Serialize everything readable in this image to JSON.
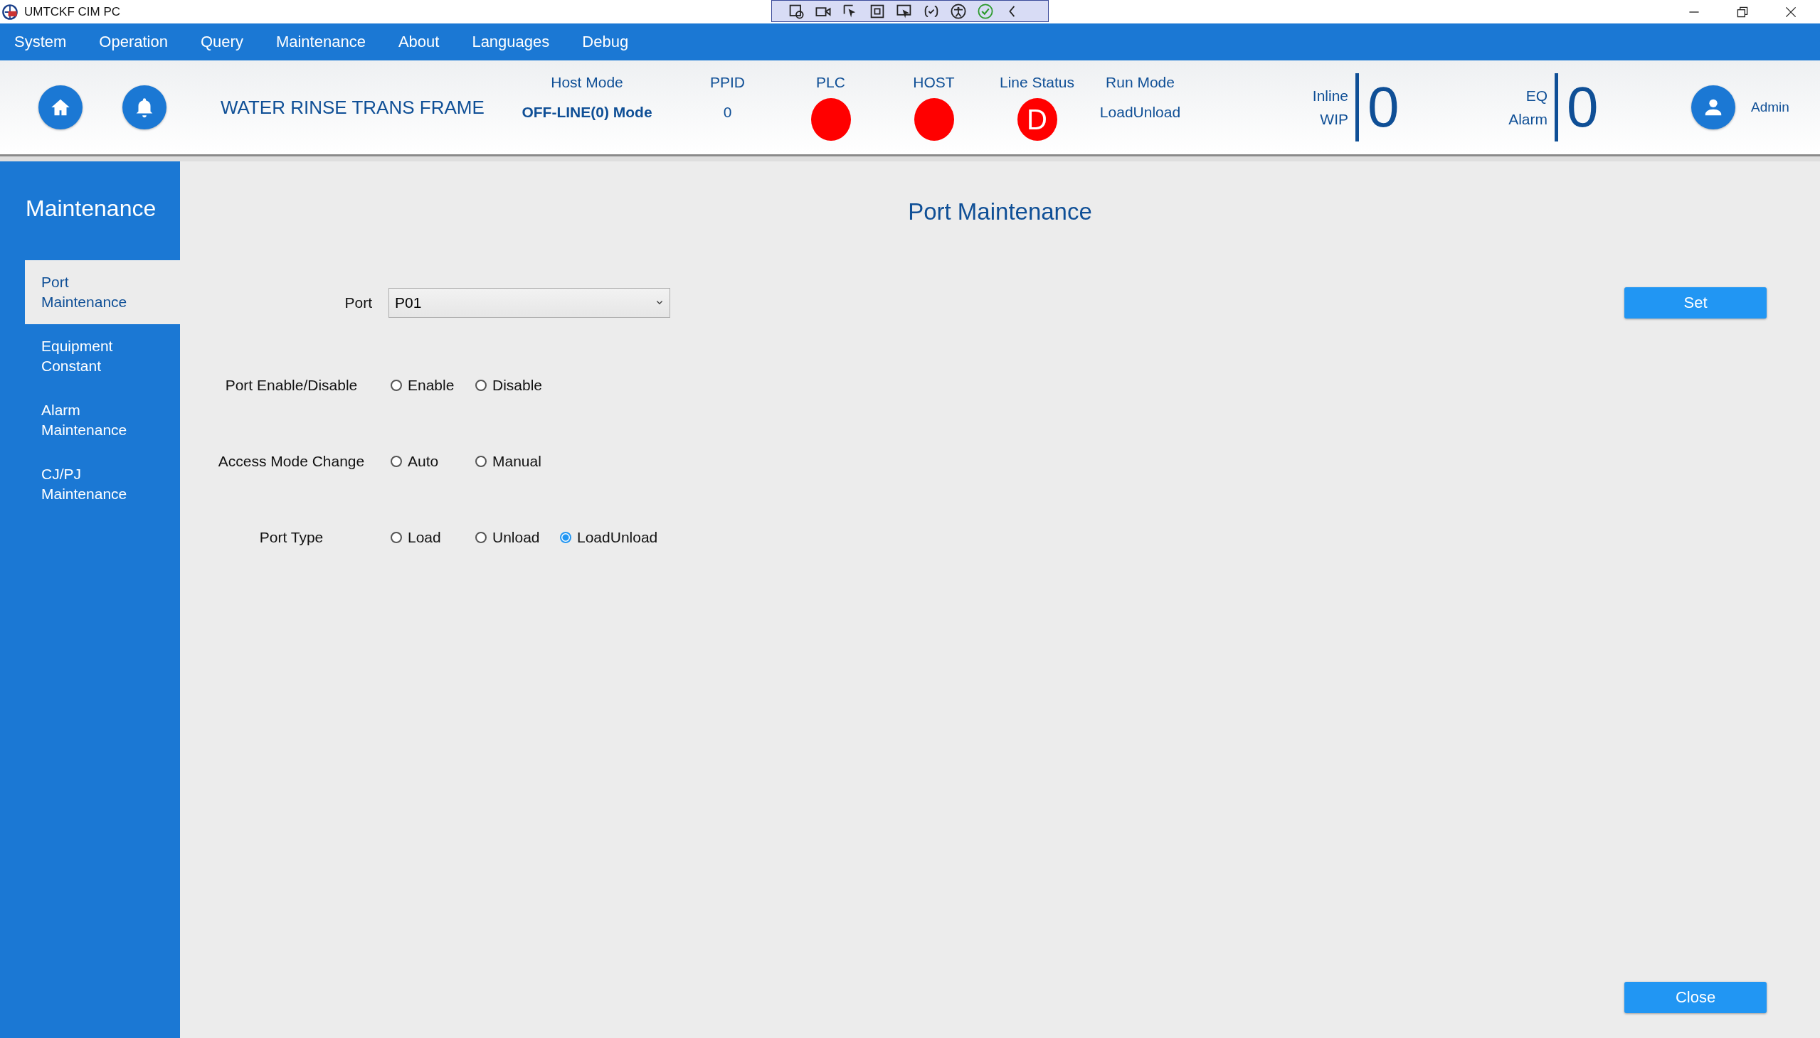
{
  "window": {
    "title": "UMTCKF CIM PC"
  },
  "menu": [
    "System",
    "Operation",
    "Query",
    "Maintenance",
    "About",
    "Languages",
    "Debug"
  ],
  "header": {
    "title": "WATER RINSE TRANS FRAME",
    "status": [
      {
        "label": "Host Mode",
        "kind": "text",
        "value": "OFF-LINE(0) Mode",
        "bold": true
      },
      {
        "label": "PPID",
        "kind": "text",
        "value": "0",
        "bold": false
      },
      {
        "label": "PLC",
        "kind": "lamp",
        "color": "#ff0000"
      },
      {
        "label": "HOST",
        "kind": "lamp",
        "color": "#ff0000"
      },
      {
        "label": "Line Status",
        "kind": "lamp",
        "color": "#ff0000",
        "value": "D"
      },
      {
        "label": "Run Mode",
        "kind": "text",
        "value": "LoadUnload",
        "bold": false
      }
    ],
    "counters": [
      {
        "label": "Inline WIP",
        "value": "0"
      },
      {
        "label": "EQ Alarm",
        "value": "0"
      }
    ],
    "user": "Admin"
  },
  "sidebar": {
    "title": "Maintenance",
    "items": [
      {
        "label": "Port Maintenance",
        "selected": true
      },
      {
        "label": "Equipment Constant",
        "selected": false
      },
      {
        "label": "Alarm Maintenance",
        "selected": false
      },
      {
        "label": "CJ/PJ Maintenance",
        "selected": false
      }
    ]
  },
  "content": {
    "title": "Port Maintenance",
    "port": {
      "label": "Port",
      "value": "P01"
    },
    "groups": [
      {
        "label": "Port Enable/Disable",
        "options": [
          {
            "label": "Enable",
            "selected": false
          },
          {
            "label": "Disable",
            "selected": false
          }
        ]
      },
      {
        "label": "Access Mode Change",
        "options": [
          {
            "label": "Auto",
            "selected": false
          },
          {
            "label": "Manual",
            "selected": false
          }
        ]
      },
      {
        "label": "Port Type",
        "options": [
          {
            "label": "Load",
            "selected": false
          },
          {
            "label": "Unload",
            "selected": false
          },
          {
            "label": "LoadUnload",
            "selected": true
          }
        ]
      }
    ],
    "set_button": "Set",
    "close_button": "Close"
  }
}
